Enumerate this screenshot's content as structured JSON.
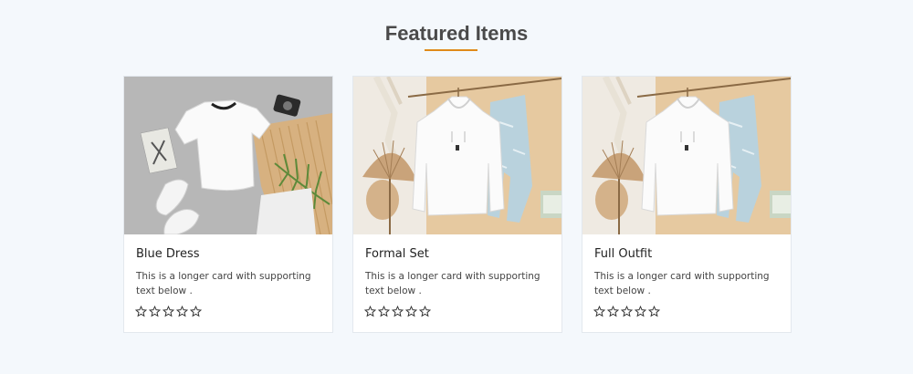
{
  "section": {
    "title": "Featured Items"
  },
  "cards": [
    {
      "title": "Blue Dress",
      "text": "This is a longer card with supporting text below .",
      "rating": 0,
      "max_rating": 5
    },
    {
      "title": "Formal Set",
      "text": "This is a longer card with supporting text below .",
      "rating": 0,
      "max_rating": 5
    },
    {
      "title": "Full Outfit",
      "text": "This is a longer card with supporting text below .",
      "rating": 0,
      "max_rating": 5
    }
  ],
  "colors": {
    "background": "#f4f8fc",
    "accent_underline": "#e08a1a",
    "heading": "#4a4a4a"
  }
}
